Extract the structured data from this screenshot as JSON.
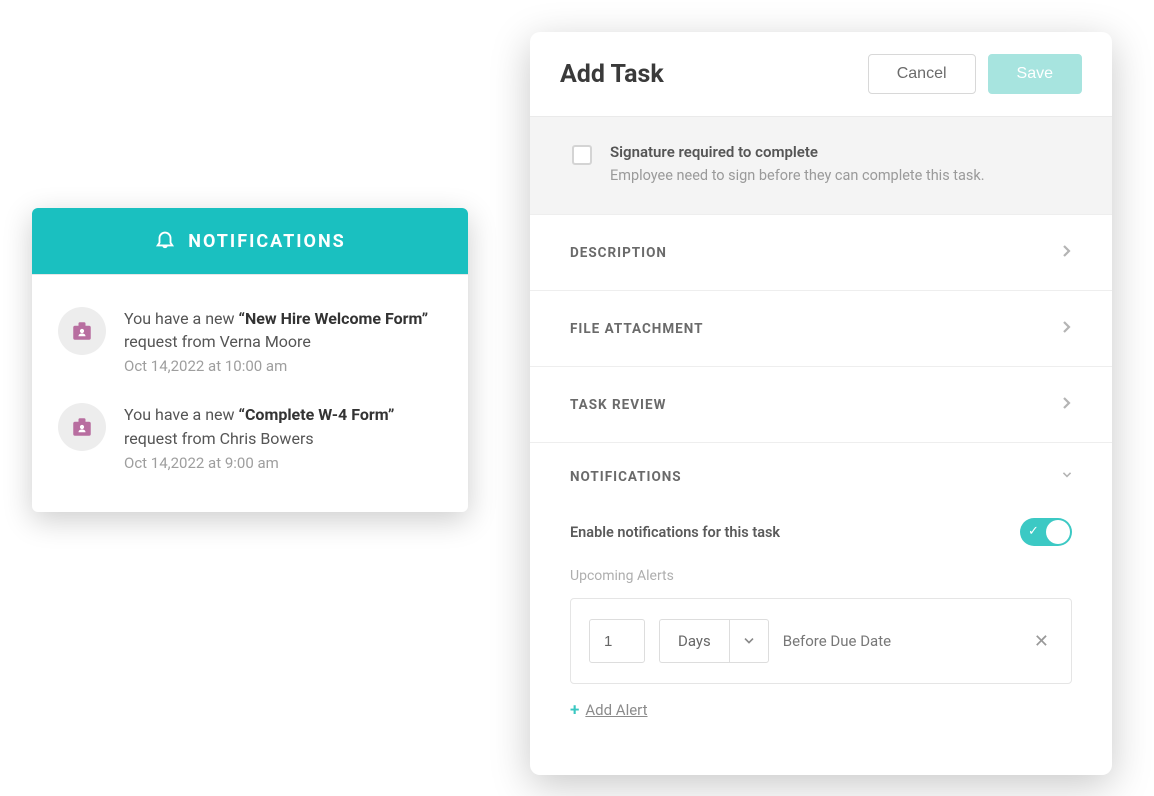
{
  "notifications_card": {
    "title": "NOTIFICATIONS",
    "items": [
      {
        "prefix": "You have a new ",
        "bold": "“New Hire Welcome Form”",
        "suffix": " request from Verna Moore",
        "time": "Oct 14,2022 at 10:00 am"
      },
      {
        "prefix": "You have a new ",
        "bold": "“Complete W-4 Form”",
        "suffix": " request from Chris Bowers",
        "time": "Oct 14,2022 at 9:00 am"
      }
    ]
  },
  "task_panel": {
    "title": "Add Task",
    "cancel_label": "Cancel",
    "save_label": "Save",
    "signature": {
      "title": "Signature required to complete",
      "subtitle": "Employee need to sign before they can complete this task."
    },
    "sections": {
      "description": "DESCRIPTION",
      "file_attachment": "FILE ATTACHMENT",
      "task_review": "TASK REVIEW",
      "notifications": "NOTIFICATIONS"
    },
    "enable_notifications_label": "Enable notifications for this task",
    "upcoming_alerts_label": "Upcoming Alerts",
    "alert": {
      "value": "1",
      "unit": "Days",
      "relation": "Before Due Date"
    },
    "add_alert_label": "Add Alert"
  }
}
